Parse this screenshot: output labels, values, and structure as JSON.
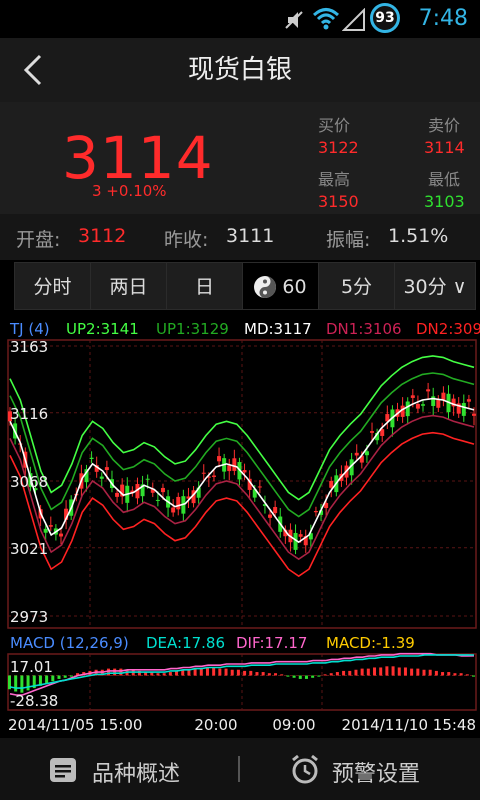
{
  "status_bar": {
    "time": "7:48",
    "battery_badge": "93",
    "icons": [
      "mute-icon",
      "wifi-icon",
      "signal-icon"
    ]
  },
  "header": {
    "title": "现货白银",
    "back_icon": "chevron-left-icon"
  },
  "quote": {
    "price": "3114",
    "change": "3  +0.10%",
    "buy_label": "买价",
    "buy_value": "3122",
    "sell_label": "卖价",
    "sell_value": "3114",
    "high_label": "最高",
    "high_value": "3150",
    "low_label": "最低",
    "low_value": "3103"
  },
  "summary": {
    "open_label": "开盘:",
    "open_value": "3112",
    "prev_close_label": "昨收:",
    "prev_close_value": "3111",
    "amplitude_label": "振幅:",
    "amplitude_value": "1.51%"
  },
  "tabs": [
    {
      "label": "分时"
    },
    {
      "label": "两日"
    },
    {
      "label": "日"
    },
    {
      "label": "60"
    },
    {
      "label": "5分"
    },
    {
      "label": "30分 ∨"
    }
  ],
  "active_tab": 3,
  "chart_data": [
    {
      "type": "line",
      "header": {
        "name": "TJ (4)",
        "up2": "UP2:3141",
        "up1": "UP1:3129",
        "md": "MD:3117",
        "dn1": "DN1:3106",
        "dn2": "DN2:309"
      },
      "y_ticks": [
        "3163",
        "3116",
        "3068",
        "3021",
        "2973"
      ],
      "ylim": [
        2973,
        3163
      ],
      "x_labels": [
        "2014/11/05 15:00",
        "20:00",
        "09:00",
        "2014/11/10 15:48"
      ],
      "series": [
        {
          "name": "MD",
          "color": "#ffffff",
          "values": [
            3110,
            3095,
            3070,
            3045,
            3030,
            3035,
            3050,
            3070,
            3080,
            3075,
            3065,
            3058,
            3060,
            3065,
            3062,
            3055,
            3050,
            3052,
            3060,
            3070,
            3078,
            3080,
            3078,
            3070,
            3060,
            3050,
            3040,
            3030,
            3025,
            3030,
            3045,
            3060,
            3070,
            3078,
            3085,
            3095,
            3105,
            3112,
            3118,
            3122,
            3125,
            3126,
            3125,
            3122,
            3120,
            3118
          ]
        },
        {
          "name": "UP1",
          "color": "#22aa22",
          "values": [
            3128,
            3113,
            3088,
            3063,
            3048,
            3053,
            3068,
            3088,
            3098,
            3093,
            3083,
            3076,
            3078,
            3083,
            3080,
            3073,
            3068,
            3070,
            3078,
            3088,
            3096,
            3098,
            3096,
            3088,
            3078,
            3068,
            3058,
            3048,
            3043,
            3048,
            3063,
            3078,
            3088,
            3096,
            3103,
            3113,
            3123,
            3130,
            3136,
            3140,
            3143,
            3144,
            3143,
            3140,
            3138,
            3136
          ]
        },
        {
          "name": "UP2",
          "color": "#44ff44",
          "values": [
            3140,
            3125,
            3100,
            3075,
            3060,
            3065,
            3080,
            3100,
            3110,
            3105,
            3095,
            3088,
            3090,
            3095,
            3092,
            3085,
            3080,
            3082,
            3090,
            3100,
            3108,
            3110,
            3108,
            3100,
            3090,
            3080,
            3070,
            3060,
            3055,
            3060,
            3075,
            3090,
            3100,
            3108,
            3115,
            3125,
            3135,
            3142,
            3148,
            3152,
            3155,
            3156,
            3155,
            3152,
            3150,
            3148
          ]
        },
        {
          "name": "DN1",
          "color": "#aa2244",
          "values": [
            3098,
            3083,
            3058,
            3033,
            3018,
            3023,
            3038,
            3058,
            3068,
            3063,
            3053,
            3046,
            3048,
            3053,
            3050,
            3043,
            3038,
            3040,
            3048,
            3058,
            3066,
            3068,
            3066,
            3058,
            3048,
            3038,
            3028,
            3018,
            3013,
            3018,
            3033,
            3048,
            3058,
            3066,
            3073,
            3083,
            3093,
            3100,
            3106,
            3110,
            3113,
            3114,
            3113,
            3110,
            3108,
            3106
          ]
        },
        {
          "name": "DN2",
          "color": "#ff2222",
          "values": [
            3086,
            3071,
            3046,
            3021,
            3006,
            3011,
            3026,
            3046,
            3056,
            3051,
            3041,
            3034,
            3036,
            3041,
            3038,
            3031,
            3026,
            3028,
            3036,
            3046,
            3054,
            3056,
            3054,
            3046,
            3036,
            3026,
            3016,
            3006,
            3001,
            3006,
            3021,
            3036,
            3046,
            3054,
            3061,
            3071,
            3081,
            3088,
            3094,
            3098,
            3101,
            3102,
            3101,
            3098,
            3096,
            3094
          ]
        }
      ]
    },
    {
      "type": "bar",
      "header": {
        "name": "MACD (12,26,9)",
        "dea": "DEA:17.86",
        "dif": "DIF:17.17",
        "macd": "MACD:-1.39"
      },
      "y_ticks": [
        "17.01",
        "-28.38"
      ],
      "ylim": [
        -28.38,
        17.01
      ],
      "values": [
        -12,
        -14,
        -15,
        -13,
        -11,
        -9,
        -7,
        -5,
        -3,
        -2,
        -1,
        2,
        3,
        4,
        5,
        5,
        6,
        6,
        6,
        5,
        5,
        4,
        3,
        3,
        2,
        2,
        3,
        4,
        5,
        5,
        6,
        6,
        7,
        7,
        6,
        6,
        5,
        5,
        4,
        4,
        3,
        3,
        2,
        2,
        1,
        -1,
        -2,
        -3,
        -3,
        -2,
        -1,
        1,
        2,
        3,
        4,
        4,
        5,
        6,
        6,
        7,
        7,
        8,
        8,
        7,
        7,
        6,
        6,
        5,
        5,
        4,
        3,
        3,
        2,
        2,
        1,
        -1
      ],
      "dea": [
        -10,
        -11,
        -11,
        -10,
        -9,
        -8,
        -7,
        -6,
        -5,
        -4,
        -3,
        -2,
        -1,
        0,
        1,
        1,
        2,
        2,
        2,
        3,
        3,
        3,
        3,
        3,
        3,
        3,
        4,
        4,
        5,
        5,
        6,
        6,
        7,
        7,
        7,
        8,
        8,
        8,
        8,
        9,
        9,
        9,
        9,
        10,
        10,
        10,
        10,
        10,
        10,
        11,
        11,
        11,
        12,
        12,
        13,
        13,
        14,
        14,
        15,
        15,
        16,
        16,
        16,
        17,
        17,
        17,
        17,
        18,
        18,
        18,
        18,
        18,
        18,
        18,
        18,
        17.86
      ],
      "dif": [
        -16,
        -17,
        -17,
        -15,
        -13,
        -11,
        -9,
        -7,
        -5,
        -4,
        -2,
        0,
        1,
        2,
        3,
        3,
        4,
        4,
        4,
        5,
        5,
        5,
        5,
        5,
        5,
        5,
        6,
        6,
        7,
        7,
        8,
        8,
        9,
        9,
        9,
        10,
        10,
        10,
        10,
        11,
        11,
        11,
        11,
        12,
        12,
        12,
        12,
        12,
        12,
        13,
        13,
        13,
        14,
        14,
        15,
        15,
        16,
        16,
        17,
        17,
        18,
        18,
        18,
        19,
        19,
        19,
        19,
        19,
        19,
        18,
        18,
        18,
        18,
        17,
        17,
        17.17
      ]
    }
  ],
  "footer": {
    "overview_label": "品种概述",
    "overview_icon": "document-icon",
    "alert_label": "预警设置",
    "alert_icon": "alarm-clock-icon"
  }
}
